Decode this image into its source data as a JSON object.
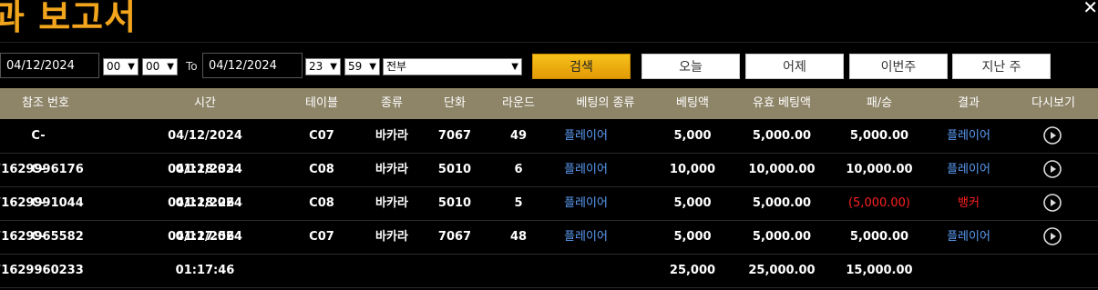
{
  "title": "과 보고서",
  "filters": {
    "from_date": "04/12/2024",
    "from_hour": "00",
    "from_min": "00",
    "to_label": "To",
    "to_date": "04/12/2024",
    "to_hour": "23",
    "to_min": "59",
    "type_select": "전부"
  },
  "buttons": {
    "search": "검색",
    "today": "오늘",
    "yesterday": "어제",
    "this_week": "이번주",
    "last_week": "지난 주"
  },
  "columns": [
    "참조 번호",
    "시간",
    "테이블",
    "종류",
    "단화",
    "라운드",
    "베팅의 종류",
    "베팅액",
    "유효 베팅액",
    "패/승",
    "결과",
    "다시보기"
  ],
  "rows": [
    {
      "ref": "C-71629996176",
      "time": "04/12/2024 01:18:33",
      "table": "C07",
      "kind": "바카라",
      "shoe": "7067",
      "round": "49",
      "bet_type": "플레이어",
      "bet": "5,000",
      "valid": "5,000.00",
      "winloss": "5,000.00",
      "result": "플레이어",
      "result_color": "blue"
    },
    {
      "ref": "C-71629991044",
      "time": "04/12/2024 01:18:26",
      "table": "C08",
      "kind": "바카라",
      "shoe": "5010",
      "round": "6",
      "bet_type": "플레이어",
      "bet": "10,000",
      "valid": "10,000.00",
      "winloss": "10,000.00",
      "result": "플레이어",
      "result_color": "blue"
    },
    {
      "ref": "C-71629965582",
      "time": "04/12/2024 01:17:56",
      "table": "C08",
      "kind": "바카라",
      "shoe": "5010",
      "round": "5",
      "bet_type": "플레이어",
      "bet": "5,000",
      "valid": "5,000.00",
      "winloss": "(5,000.00)",
      "result": "뱅커",
      "result_color": "red"
    },
    {
      "ref": "C-71629960233",
      "time": "04/12/2024 01:17:46",
      "table": "C07",
      "kind": "바카라",
      "shoe": "7067",
      "round": "48",
      "bet_type": "플레이어",
      "bet": "5,000",
      "valid": "5,000.00",
      "winloss": "5,000.00",
      "result": "플레이어",
      "result_color": "blue"
    }
  ],
  "totals": {
    "bet": "25,000",
    "valid": "25,000.00",
    "winloss": "15,000.00"
  },
  "colors": {
    "accent": "#f2a51c",
    "header_bg": "#8e8468",
    "link_blue": "#5b9bf3",
    "loss_red": "#ff2020"
  },
  "icons": {
    "close": "close-icon",
    "replay": "play-circle-icon"
  }
}
